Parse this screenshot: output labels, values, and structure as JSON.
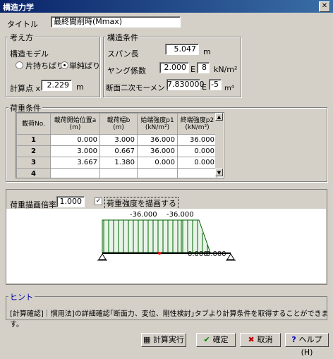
{
  "window": {
    "title": "構造力学"
  },
  "title_field": {
    "label": "タイトル",
    "value": "最終間削時(Mmax)"
  },
  "thinking": {
    "group_label": "考え方",
    "model_label": "構造モデル",
    "option_cantilever": "片持ちばり",
    "option_simple": "単純ばり",
    "selected": "単純ばり",
    "calc_point_label": "計算点 x",
    "calc_point_value": "2.229",
    "calc_point_unit": "m"
  },
  "structure": {
    "group_label": "構造条件",
    "span_label": "スパン長",
    "span_value": "5.047",
    "span_unit": "m",
    "young_label": "ヤング係数",
    "young_mantissa": "2.000",
    "young_E": "E",
    "young_exp": "8",
    "young_unit": "kN/m²",
    "inertia_label": "断面二次モーメント",
    "inertia_mantissa": "7.830000",
    "inertia_E": "E",
    "inertia_exp": "-5",
    "inertia_unit": "m⁴"
  },
  "loads": {
    "group_label": "荷重条件",
    "headers": [
      "載荷No.",
      "載荷開始位置a\n(m)",
      "載荷幅b\n(m)",
      "始端強度p1\n(kN/m²)",
      "終端強度p2\n(kN/m²)"
    ],
    "rows": [
      {
        "no": "1",
        "a": "0.000",
        "b": "3.000",
        "p1": "36.000",
        "p2": "36.000"
      },
      {
        "no": "2",
        "a": "3.000",
        "b": "0.667",
        "p1": "36.000",
        "p2": "0.000"
      },
      {
        "no": "3",
        "a": "3.667",
        "b": "1.380",
        "p1": "0.000",
        "p2": "0.000"
      },
      {
        "no": "4",
        "a": "",
        "b": "",
        "p1": "",
        "p2": ""
      }
    ]
  },
  "drawing": {
    "scale_label": "荷重描画倍率",
    "scale_value": "1.000",
    "checkbox_label": "荷重強度を描画する",
    "checked": true,
    "label_left": "-36.000",
    "label_right": "-36.000",
    "label_zero1": "0.000",
    "label_zero2": "0.000"
  },
  "hint": {
    "label": "ヒント",
    "text": "[計算確認]｜慣用法]の詳細確認｢断面力、変位、剛性検討｣タブより計算条件を取得することができます。"
  },
  "buttons": {
    "calculate": "計算実行",
    "ok": "確定",
    "cancel": "取消",
    "help": "ヘルプ(H)"
  },
  "colors": {
    "load": "#006400",
    "titlebar": "#0a246a"
  }
}
